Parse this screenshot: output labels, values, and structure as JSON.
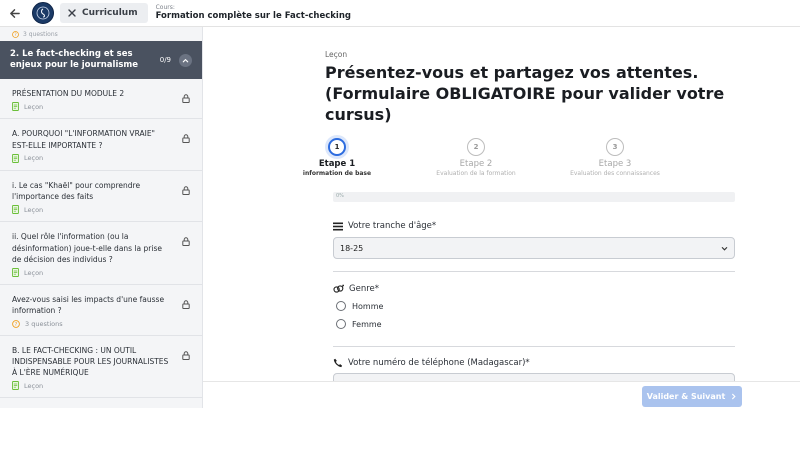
{
  "topbar": {
    "curriculum_label": "Curriculum",
    "course_prefix": "Cours:",
    "course_title": "Formation complète sur le Fact-checking"
  },
  "sidebar": {
    "prev_meta": "3 questions",
    "module": {
      "title": "2. Le fact-checking et ses enjeux pour le journalisme",
      "count": "0/9"
    },
    "items": [
      {
        "title": "PRÉSENTATION DU MODULE 2",
        "meta": "Leçon",
        "type": "lesson"
      },
      {
        "title": "A. POURQUOI \"L'INFORMATION VRAIE\" EST-ELLE IMPORTANTE ?",
        "meta": "Leçon",
        "type": "lesson"
      },
      {
        "title": "i. Le cas \"Khaël\" pour comprendre l'importance des faits",
        "meta": "Leçon",
        "type": "lesson"
      },
      {
        "title": "ii. Quel rôle l'information (ou la désinformation) joue-t-elle dans la prise de décision des individus ?",
        "meta": "Leçon",
        "type": "lesson"
      },
      {
        "title": "Avez-vous saisi les impacts d'une fausse information ?",
        "meta": "3 questions",
        "type": "quiz"
      },
      {
        "title": "B. LE FACT-CHECKING : UN OUTIL INDISPENSABLE POUR LES JOURNALISTES À L'ÈRE NUMÉRIQUE",
        "meta": "Leçon",
        "type": "lesson"
      }
    ]
  },
  "main": {
    "kicker": "Leçon",
    "title": "Présentez-vous et partagez vos attentes. (Formulaire OBLIGATOIRE pour valider votre cursus)",
    "steps": [
      {
        "num": "1",
        "name": "Etape 1",
        "sub": "information de base",
        "active": true
      },
      {
        "num": "2",
        "name": "Etape 2",
        "sub": "Evaluation de la formation",
        "active": false
      },
      {
        "num": "3",
        "name": "Etape 3",
        "sub": "Evaluation des connaissances",
        "active": false
      }
    ],
    "progress": {
      "percent": 0,
      "label": "0%"
    },
    "age": {
      "label": "Votre tranche d'âge*",
      "value": "18-25"
    },
    "gender": {
      "label": "Genre*",
      "options": [
        "Homme",
        "Femme"
      ]
    },
    "phone": {
      "label": "Votre numéro de téléphone (Madagascar)*"
    }
  },
  "actions": {
    "next_label": "Valider & Suivant"
  },
  "colors": {
    "accent": "#2d6cdf",
    "sidebar_module": "#4a5260",
    "button_disabled": "#aac3ee"
  }
}
